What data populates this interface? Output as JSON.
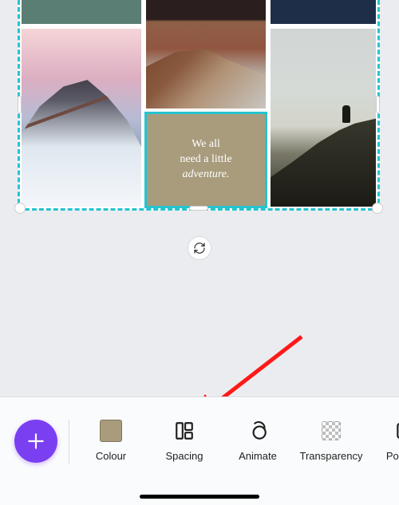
{
  "accent": "#25c4cf",
  "collage": {
    "quote": {
      "line1": "We all",
      "line2": "need a little",
      "line3": "adventure.",
      "bg": "#a89c7d"
    }
  },
  "toolbar": {
    "fab_label": "+",
    "items": [
      {
        "key": "colour",
        "label": "Colour"
      },
      {
        "key": "spacing",
        "label": "Spacing"
      },
      {
        "key": "animate",
        "label": "Animate"
      },
      {
        "key": "transparency",
        "label": "Transparency"
      },
      {
        "key": "position",
        "label": "Position"
      }
    ]
  },
  "annotation": {
    "target": "spacing"
  }
}
